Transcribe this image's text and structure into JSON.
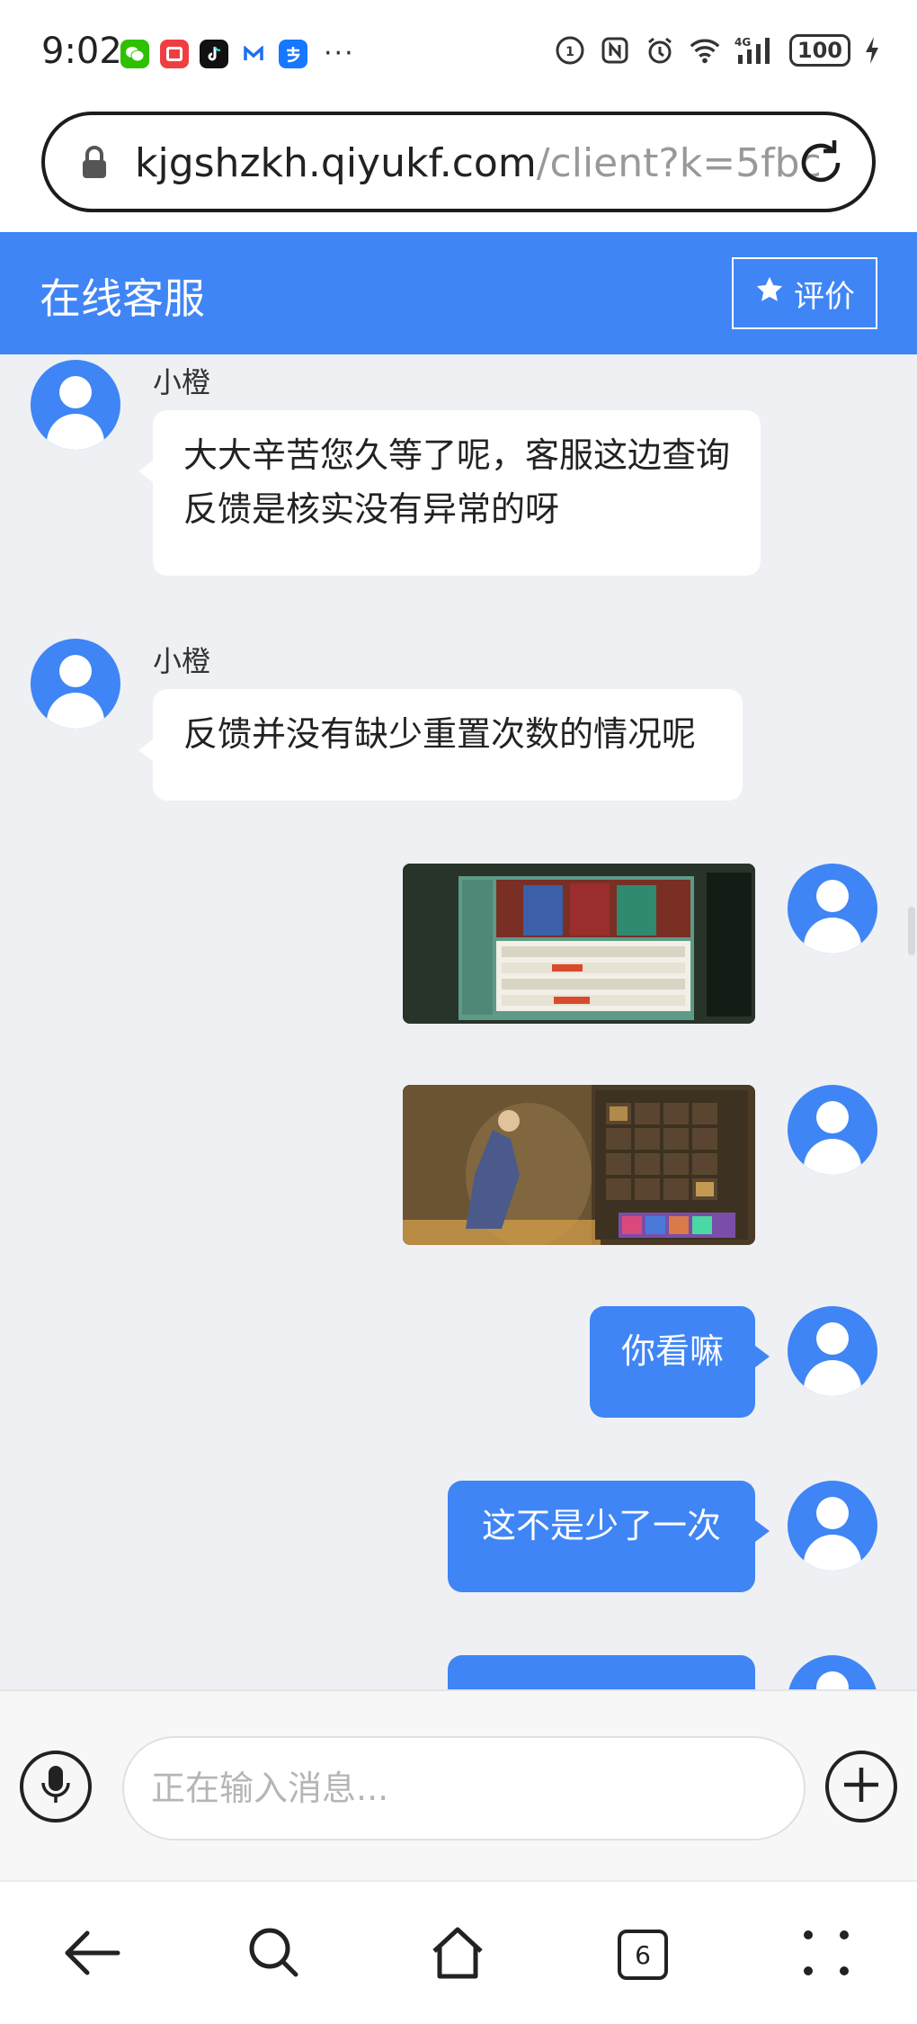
{
  "status_bar": {
    "time": "9:02",
    "app_icons": [
      "wechat-icon",
      "red-app-icon",
      "tiktok-icon",
      "m-app-icon",
      "alipay-icon"
    ],
    "more": "···",
    "battery": "100"
  },
  "browser": {
    "url_host": "kjgshzkh.qiyukf.com",
    "url_path": "/client?k=5fbc",
    "tab_count": "6"
  },
  "header": {
    "title": "在线客服",
    "rate_label": "评价"
  },
  "messages": [
    {
      "sender": "小橙",
      "text": "大大辛苦您久等了呢，客服这边查询反馈是核实没有异常的呀"
    },
    {
      "sender": "小橙",
      "text": "反馈并没有缺少重置次数的情况呢"
    },
    {
      "type": "image",
      "from": "user"
    },
    {
      "type": "image",
      "from": "user"
    },
    {
      "text": "你看嘛",
      "from": "user"
    },
    {
      "text": "这不是少了一次",
      "from": "user"
    }
  ],
  "input": {
    "placeholder": "正在输入消息..."
  },
  "colors": {
    "accent": "#3f85f5",
    "chat_bg": "#eef0f3"
  }
}
